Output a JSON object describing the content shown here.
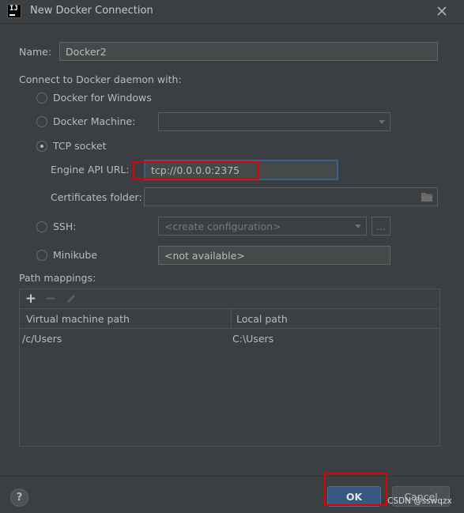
{
  "window": {
    "title": "New Docker Connection",
    "app_icon_text": "IJ"
  },
  "form": {
    "name_label": "Name:",
    "name_value": "Docker2",
    "connect_label": "Connect to Docker daemon with:",
    "options": {
      "docker_for_windows": "Docker for Windows",
      "docker_machine": "Docker Machine:",
      "tcp_socket": "TCP socket",
      "ssh": "SSH:",
      "minikube": "Minikube"
    },
    "selected_option": "tcp_socket",
    "docker_machine_value": "",
    "engine_api_label": "Engine API URL:",
    "engine_api_value": "tcp://0.0.0.0:2375",
    "certificates_label": "Certificates folder:",
    "certificates_value": "",
    "ssh_placeholder": "<create configuration>",
    "ssh_more_label": "...",
    "minikube_value": "<not available>"
  },
  "path_mappings": {
    "label": "Path mappings:",
    "toolbar": {
      "add": "+",
      "remove": "−"
    },
    "columns": [
      "Virtual machine path",
      "Local path"
    ],
    "rows": [
      {
        "vm_path": "/c/Users",
        "local_path": "C:\\Users"
      }
    ]
  },
  "footer": {
    "help_label": "?",
    "ok_label": "OK",
    "cancel_label": "Cancel"
  },
  "watermark": "CSDN @sswqzx",
  "colors": {
    "background": "#3c3f41",
    "accent": "#365880",
    "focus_border": "#3d6185",
    "annotation_red": "#e00000"
  }
}
